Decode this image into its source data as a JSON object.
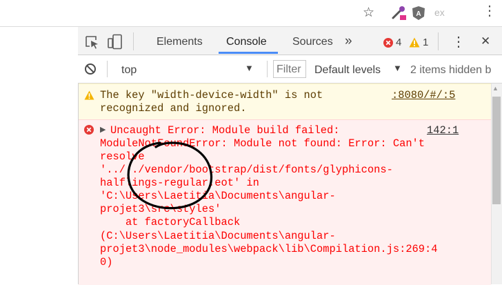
{
  "browser": {
    "ext_badge_text": "ex"
  },
  "devtools": {
    "tabs": [
      "Elements",
      "Console",
      "Sources"
    ],
    "active_tab": "Console",
    "more_tabs": "»",
    "error_count": "4",
    "warning_count": "1",
    "close": "✕"
  },
  "console": {
    "context": "top",
    "filter_placeholder": "Filter",
    "levels_label": "Default levels",
    "hidden_items": "2 items hidden b"
  },
  "messages": {
    "warning": {
      "lines": [
        "The key \"width-device-width\" is not",
        "recognized and ignored."
      ],
      "source": ":8080/#/:5"
    },
    "error": {
      "first_line": "Uncaught Error: Module build failed:",
      "source": "142:1",
      "lines": [
        "ModuleNotFoundError: Module not found: Error: Can't",
        "resolve",
        "'../../vendor/bootstrap/dist/fonts/glyphicons-",
        "halflings-regular.eot' in",
        "'C:\\Users\\Laetitia\\Documents\\angular-",
        "projet3\\src\\styles'",
        "    at factoryCallback",
        "(C:\\Users\\Laetitia\\Documents\\angular-",
        "projet3\\node_modules\\webpack\\lib\\Compilation.js:269:4",
        "0)"
      ]
    }
  },
  "colors": {
    "error_red": "#fc0000",
    "warning_bg": "#fffbe5",
    "error_bg": "#fff0f0",
    "active_tab_underline": "#4a8cf7",
    "annotation_circle": "#000000"
  }
}
